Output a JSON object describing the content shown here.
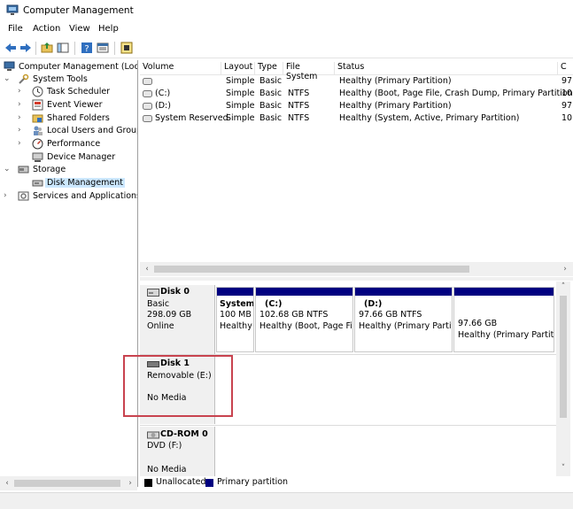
{
  "window": {
    "title": "Computer Management"
  },
  "menu": [
    "File",
    "Action",
    "View",
    "Help"
  ],
  "tree": {
    "root": "Computer Management (Local",
    "items": [
      {
        "label": "System Tools",
        "icon": "tools-icon"
      },
      {
        "label": "Task Scheduler",
        "icon": "clock-icon"
      },
      {
        "label": "Event Viewer",
        "icon": "event-viewer-icon"
      },
      {
        "label": "Shared Folders",
        "icon": "shared-folder-icon"
      },
      {
        "label": "Local Users and Groups",
        "icon": "users-icon"
      },
      {
        "label": "Performance",
        "icon": "performance-icon"
      },
      {
        "label": "Device Manager",
        "icon": "device-manager-icon"
      },
      {
        "label": "Storage",
        "icon": "storage-icon"
      },
      {
        "label": "Disk Management",
        "icon": "disk-management-icon"
      },
      {
        "label": "Services and Applications",
        "icon": "services-icon"
      }
    ]
  },
  "volume_list": {
    "columns": [
      "Volume",
      "Layout",
      "Type",
      "File System",
      "Status",
      "C"
    ],
    "rows": [
      {
        "volume": "",
        "layout": "Simple",
        "type": "Basic",
        "fs": "",
        "status": "Healthy (Primary Partition)",
        "c": "97"
      },
      {
        "volume": "(C:)",
        "layout": "Simple",
        "type": "Basic",
        "fs": "NTFS",
        "status": "Healthy (Boot, Page File, Crash Dump, Primary Partition)",
        "c": "10"
      },
      {
        "volume": "(D:)",
        "layout": "Simple",
        "type": "Basic",
        "fs": "NTFS",
        "status": "Healthy (Primary Partition)",
        "c": "97"
      },
      {
        "volume": "System Reserved",
        "layout": "Simple",
        "type": "Basic",
        "fs": "NTFS",
        "status": "Healthy (System, Active, Primary Partition)",
        "c": "10"
      }
    ]
  },
  "disks": {
    "disk0": {
      "name": "Disk 0",
      "type": "Basic",
      "size": "298.09 GB",
      "status": "Online",
      "partitions": [
        {
          "name": "System",
          "size": "100 MB",
          "status": "Healthy"
        },
        {
          "name": "(C:)",
          "size": "102.68 GB NTFS",
          "status": "Healthy (Boot, Page Fil"
        },
        {
          "name": "(D:)",
          "size": "97.66 GB NTFS",
          "status": "Healthy (Primary Partiti"
        },
        {
          "name": "",
          "size": "97.66 GB",
          "status": "Healthy (Primary Partiti"
        }
      ]
    },
    "disk1": {
      "name": "Disk 1",
      "type": "Removable (E:)",
      "status": "No Media"
    },
    "cdrom0": {
      "name": "CD-ROM 0",
      "type": "DVD (F:)",
      "status": "No Media"
    }
  },
  "legend": {
    "unallocated": "Unallocated",
    "primary": "Primary partition"
  },
  "colors": {
    "primary_partition": "#000080",
    "unallocated": "#000000",
    "highlight": "#c8434f",
    "selection": "#cce8ff"
  }
}
